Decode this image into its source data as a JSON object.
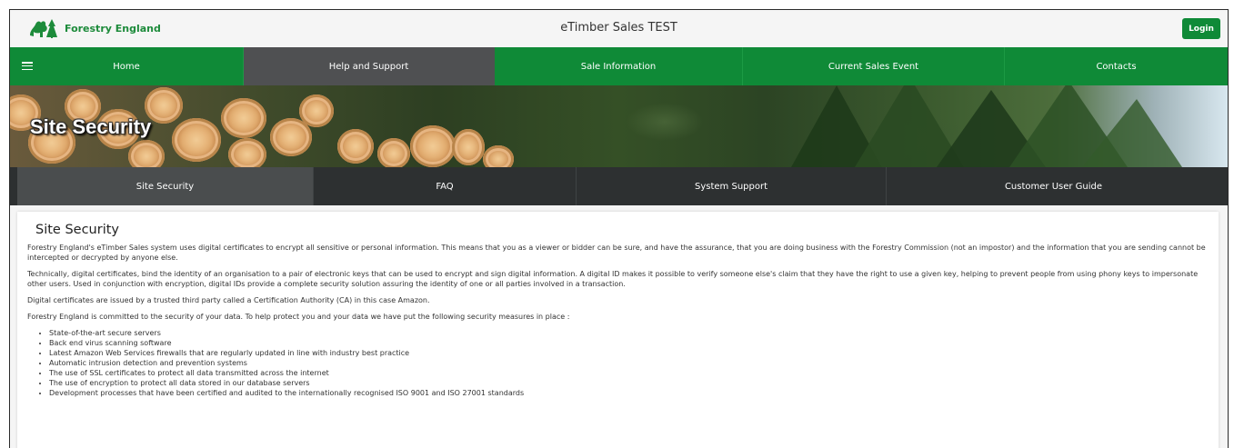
{
  "header": {
    "logo_text": "Forestry England",
    "app_title": "eTimber Sales TEST",
    "login_label": "Login"
  },
  "main_nav": {
    "items": [
      {
        "label": "Home"
      },
      {
        "label": "Help and Support"
      },
      {
        "label": "Sale Information"
      },
      {
        "label": "Current Sales Event"
      },
      {
        "label": "Contacts"
      }
    ],
    "active": "Help and Support"
  },
  "banner": {
    "title": "Site Security"
  },
  "sub_nav": {
    "items": [
      {
        "label": "Site Security"
      },
      {
        "label": "FAQ"
      },
      {
        "label": "System Support"
      },
      {
        "label": "Customer User Guide"
      }
    ],
    "active": "Site Security"
  },
  "content": {
    "heading": "Site Security",
    "paragraphs": [
      "Forestry England's eTimber Sales system uses digital certificates to encrypt all sensitive or personal information. This means that you as a viewer or bidder can be sure, and have the assurance, that you are doing business with the Forestry Commission (not an impostor) and the information that you are sending cannot be intercepted or decrypted by anyone else.",
      "Technically, digital certificates, bind the identity of an organisation to a pair of electronic keys that can be used to encrypt and sign digital information. A digital ID makes it possible to verify someone else's claim that they have the right to use a given key, helping to prevent people from using phony keys to impersonate other users. Used in conjunction with encryption, digital IDs provide a complete security solution assuring the identity of one or all parties involved in a transaction.",
      "Digital certificates are issued by a trusted third party called a Certification Authority (CA) in this case Amazon.",
      "Forestry England is committed to the security of your data. To help protect you and your data we have put the following security measures in place :"
    ],
    "measures": [
      "State-of-the-art secure servers",
      "Back end virus scanning software",
      "Latest Amazon Web Services firewalls that are regularly updated in line with industry best practice",
      "Automatic intrusion detection and prevention systems",
      "The use of SSL certificates to protect all data transmitted across the internet",
      "The use of encryption to protect all data stored in our database servers",
      "Development processes that have been certified and audited to the internationally recognised ISO 9001 and ISO 27001 standards"
    ]
  },
  "icons": {
    "logo": "tree-logo-icon",
    "menu": "hamburger-menu-icon"
  },
  "colors": {
    "brand_green": "#0f8a37",
    "active_nav": "#4f5052",
    "subnav_bg": "#2d3031"
  }
}
